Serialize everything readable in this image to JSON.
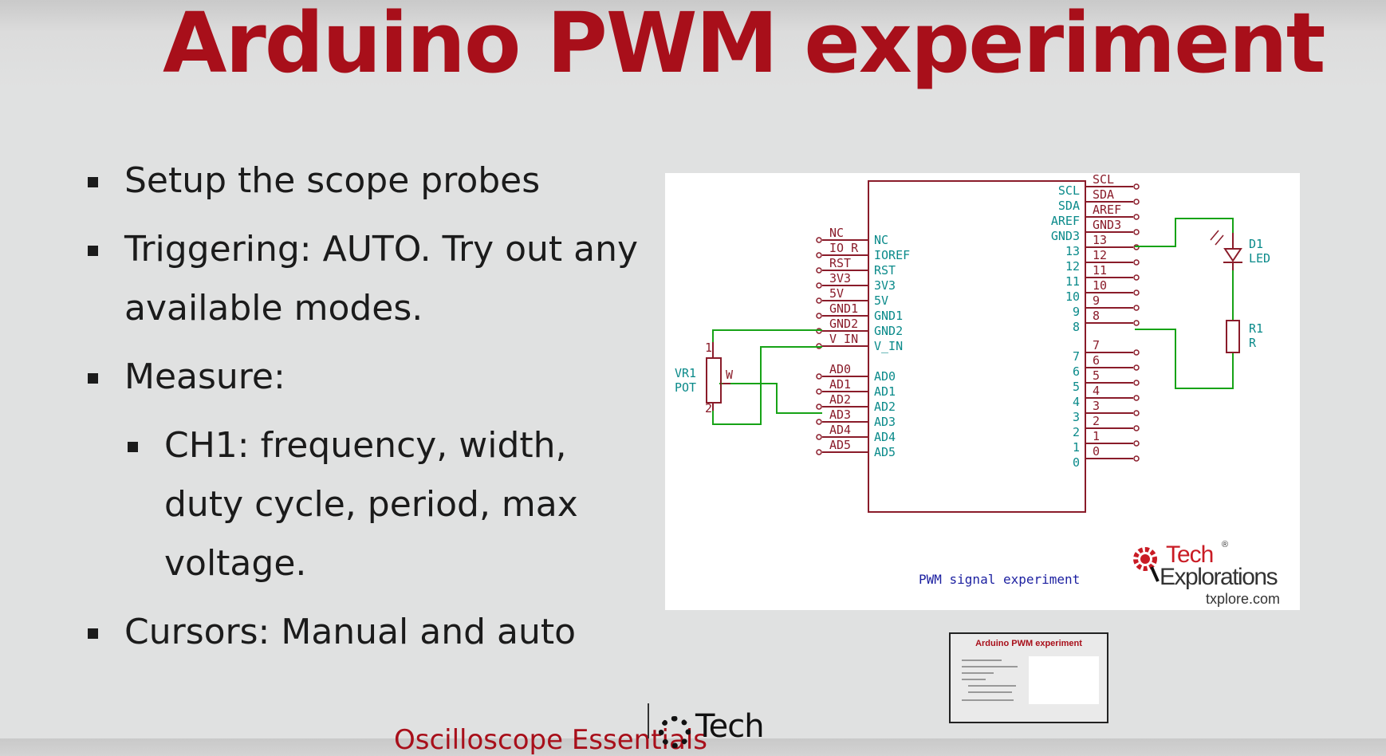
{
  "title": "Arduino PWM experiment",
  "bullets": {
    "b1": "Setup the scope probes",
    "b2": "Triggering: AUTO. Try out any available modes.",
    "b3": "Measure:",
    "b3a": "CH1: frequency, width, duty cycle, period, max voltage.",
    "b4": "Cursors: Manual and auto"
  },
  "schematic": {
    "caption": "PWM signal experiment",
    "left_pins_outer": [
      "NC",
      "IO_R",
      "RST",
      "3V3",
      "5V",
      "GND1",
      "GND2",
      "V_IN",
      "AD0",
      "AD1",
      "AD2",
      "AD3",
      "AD4",
      "AD5"
    ],
    "left_pins_inner": [
      "NC",
      "IOREF",
      "RST",
      "3V3",
      "5V",
      "GND1",
      "GND2",
      "V_IN",
      "AD0",
      "AD1",
      "AD2",
      "AD3",
      "AD4",
      "AD5"
    ],
    "right_pins_inner": [
      "SCL",
      "SDA",
      "AREF",
      "GND3",
      "13",
      "12",
      "11",
      "10",
      "9",
      "8",
      "7",
      "6",
      "5",
      "4",
      "3",
      "2",
      "1",
      "0"
    ],
    "right_pins_outer": [
      "SCL",
      "SDA",
      "AREF",
      "GND3",
      "13",
      "12",
      "11",
      "10",
      "9",
      "8",
      "7",
      "6",
      "5",
      "4",
      "3",
      "2",
      "1",
      "0"
    ],
    "pot_ref": "VR1",
    "pot_val": "POT",
    "pot_wiper": "W",
    "pot_pin1": "1",
    "pot_pin2": "2",
    "led_ref": "D1",
    "led_val": "LED",
    "res_ref": "R1",
    "res_val": "R"
  },
  "logo": {
    "line1": "Tech",
    "line2": "Explorations",
    "reg": "®",
    "url": "txplore.com"
  },
  "thumbnail": {
    "title": "Arduino PWM experiment"
  },
  "footer": {
    "course": "Oscilloscope Essentials",
    "brand": "Tech"
  },
  "colors": {
    "title": "#a80f1a",
    "schematic_pins": "#8a1c2a",
    "schematic_labels": "#0a8a8a",
    "wires": "#17a317"
  }
}
